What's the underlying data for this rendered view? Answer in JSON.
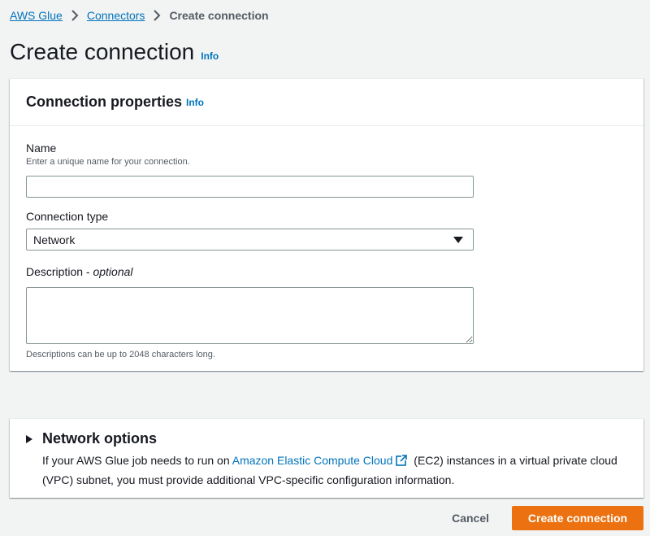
{
  "breadcrumb": {
    "items": [
      "AWS Glue",
      "Connectors"
    ],
    "current": "Create connection"
  },
  "page": {
    "title": "Create connection",
    "info": "Info"
  },
  "properties": {
    "title": "Connection properties",
    "info": "Info",
    "name": {
      "label": "Name",
      "description": "Enter a unique name for your connection.",
      "value": ""
    },
    "type": {
      "label": "Connection type",
      "value": "Network"
    },
    "description": {
      "label": "Description - ",
      "label_optional": "optional",
      "value": "",
      "constraint": "Descriptions can be up to 2048 characters long."
    }
  },
  "network": {
    "title": "Network options",
    "text_before": "If your AWS Glue job needs to run on ",
    "link": "Amazon Elastic Compute Cloud",
    "text_after": " (EC2) instances in a virtual private cloud (VPC) subnet, you must provide additional VPC-specific configuration information."
  },
  "footer": {
    "cancel": "Cancel",
    "submit": "Create connection"
  },
  "colors": {
    "link": "#0073bb",
    "primary": "#ec7211",
    "background": "#f2f3f3"
  }
}
